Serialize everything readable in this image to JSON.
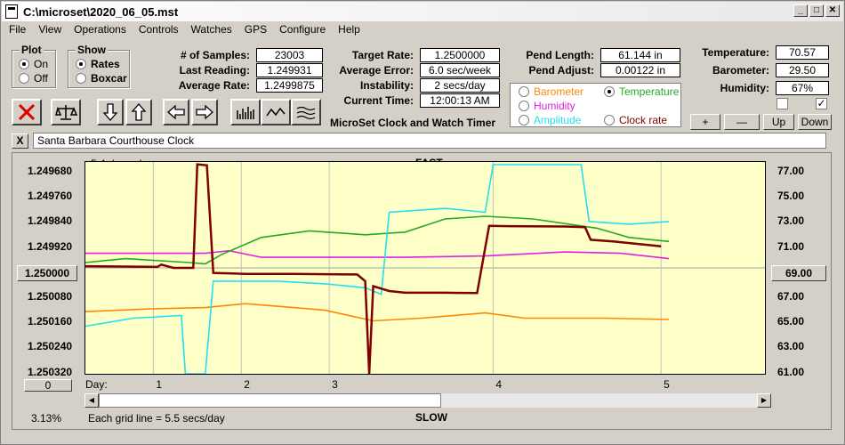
{
  "window": {
    "title": "C:\\microset\\2020_06_05.mst"
  },
  "menu": [
    "File",
    "View",
    "Operations",
    "Controls",
    "Watches",
    "GPS",
    "Configure",
    "Help"
  ],
  "plot_group": {
    "label": "Plot",
    "on": "On",
    "off": "Off"
  },
  "show_group": {
    "label": "Show",
    "rates": "Rates",
    "boxcar": "Boxcar"
  },
  "stats": {
    "samples_label": "# of Samples:",
    "samples": "23003",
    "last_label": "Last Reading:",
    "last": "1.249931",
    "avg_label": "Average Rate:",
    "avg": "1.2499875"
  },
  "rates": {
    "target_label": "Target Rate:",
    "target": "1.2500000",
    "error_label": "Average Error:",
    "error": "6.0 sec/week",
    "instability_label": "Instability:",
    "instability": "2 secs/day",
    "time_label": "Current Time:",
    "time": "12:00:13 AM"
  },
  "app_name": "MicroSet Clock and Watch Timer",
  "pend": {
    "length_label": "Pend Length:",
    "length": "61.144 in",
    "adjust_label": "Pend Adjust:",
    "adjust": "0.00122 in"
  },
  "series_select": {
    "barometer": "Barometer",
    "temperature": "Temperature",
    "humidity": "Humidity",
    "amplitude": "Amplitude",
    "clockrate": "Clock rate"
  },
  "env": {
    "temp_label": "Temperature:",
    "temp": "70.57",
    "baro_label": "Barometer:",
    "baro": "29.50",
    "hum_label": "Humidity:",
    "hum": "67%"
  },
  "env_buttons": {
    "plus": "+",
    "minus": "—",
    "up": "Up",
    "down": "Down"
  },
  "clock_name": "Santa Barbara Courthouse Clock",
  "close_x": "X",
  "plot": {
    "days_shown": "5.4 days shown",
    "fast": "FAST",
    "slow": "SLOW",
    "grid_note": "Each grid line = 5.5 secs/day",
    "percent": "3.13%",
    "day_label": "Day:",
    "zero_btn": "0",
    "center_btn": "1.250000",
    "right_btn": "69.00"
  },
  "chart_data": {
    "type": "line",
    "x_label": "Day:",
    "x_ticks": [
      "1",
      "2",
      "3",
      "4",
      "5"
    ],
    "y_left_ticks": [
      "1.249680",
      "1.249760",
      "1.249840",
      "1.249920",
      "1.250000",
      "1.250080",
      "1.250160",
      "1.250240",
      "1.250320"
    ],
    "y_right_ticks": [
      "77.00",
      "75.00",
      "73.00",
      "71.00",
      "69.00",
      "67.00",
      "65.00",
      "63.00",
      "61.00"
    ],
    "y_left_range": [
      1.24968,
      1.25032
    ],
    "y_right_range": [
      61,
      77
    ],
    "x_range": [
      0,
      8.5
    ],
    "grid": true,
    "colors": {
      "clockrate": "#800000",
      "temperature": "#22aa22",
      "humidity": "#e020e0",
      "amplitude": "#22e0f0",
      "barometer": "#ff8800"
    },
    "series": [
      {
        "name": "Clock rate",
        "points": [
          [
            0,
            1.249995
          ],
          [
            0.9,
            1.249997
          ],
          [
            0.95,
            1.24999
          ],
          [
            1.1,
            1.25
          ],
          [
            1.35,
            1.25
          ],
          [
            1.4,
            1.249687
          ],
          [
            1.52,
            1.24969
          ],
          [
            1.6,
            1.250015
          ],
          [
            2.0,
            1.250018
          ],
          [
            2.6,
            1.250018
          ],
          [
            3.4,
            1.25002
          ],
          [
            3.5,
            1.25004
          ],
          [
            3.55,
            1.25032
          ],
          [
            3.6,
            1.250055
          ],
          [
            3.8,
            1.25007
          ],
          [
            4.0,
            1.250075
          ],
          [
            4.5,
            1.250075
          ],
          [
            4.9,
            1.250076
          ],
          [
            5.05,
            1.249873
          ],
          [
            5.3,
            1.249874
          ],
          [
            6.0,
            1.249875
          ],
          [
            6.25,
            1.249877
          ],
          [
            6.32,
            1.249915
          ],
          [
            6.6,
            1.24992
          ],
          [
            7.2,
            1.249935
          ]
        ]
      },
      {
        "name": "Temperature",
        "points": [
          [
            0,
            69.4
          ],
          [
            0.5,
            69.7
          ],
          [
            1.3,
            69.4
          ],
          [
            1.5,
            69.3
          ],
          [
            1.7,
            70
          ],
          [
            2.2,
            71.3
          ],
          [
            2.8,
            71.8
          ],
          [
            3.5,
            71.5
          ],
          [
            4.0,
            71.7
          ],
          [
            4.5,
            72.7
          ],
          [
            5.0,
            72.9
          ],
          [
            5.6,
            72.7
          ],
          [
            6.4,
            72.0
          ],
          [
            6.8,
            71.3
          ],
          [
            7.3,
            71.0
          ]
        ]
      },
      {
        "name": "Humidity",
        "points": [
          [
            0,
            70.1
          ],
          [
            1.5,
            70.1
          ],
          [
            1.8,
            70.3
          ],
          [
            2.2,
            69.8
          ],
          [
            3.0,
            69.8
          ],
          [
            4.0,
            69.8
          ],
          [
            5.0,
            69.9
          ],
          [
            6.0,
            70.2
          ],
          [
            6.7,
            70.1
          ],
          [
            7.3,
            69.7
          ]
        ]
      },
      {
        "name": "Amplitude",
        "points": [
          [
            0,
            64.6
          ],
          [
            0.6,
            65.2
          ],
          [
            1.2,
            65.4
          ],
          [
            1.25,
            61.0
          ],
          [
            1.5,
            61.0
          ],
          [
            1.6,
            68.0
          ],
          [
            2.4,
            68.0
          ],
          [
            3.0,
            67.8
          ],
          [
            3.5,
            67.5
          ],
          [
            3.7,
            67.0
          ],
          [
            3.8,
            73.2
          ],
          [
            4.5,
            73.5
          ],
          [
            5.0,
            73.2
          ],
          [
            5.1,
            76.8
          ],
          [
            6.2,
            76.8
          ],
          [
            6.3,
            72.5
          ],
          [
            6.8,
            72.3
          ],
          [
            7.3,
            72.5
          ]
        ]
      },
      {
        "name": "Barometer",
        "points": [
          [
            0,
            65.7
          ],
          [
            0.8,
            65.9
          ],
          [
            1.5,
            66.0
          ],
          [
            2.0,
            66.3
          ],
          [
            2.6,
            66.0
          ],
          [
            3.0,
            65.8
          ],
          [
            3.6,
            65.0
          ],
          [
            4.2,
            65.2
          ],
          [
            5.0,
            65.6
          ],
          [
            5.5,
            65.2
          ],
          [
            6.5,
            65.2
          ],
          [
            7.3,
            65.1
          ]
        ]
      }
    ]
  }
}
